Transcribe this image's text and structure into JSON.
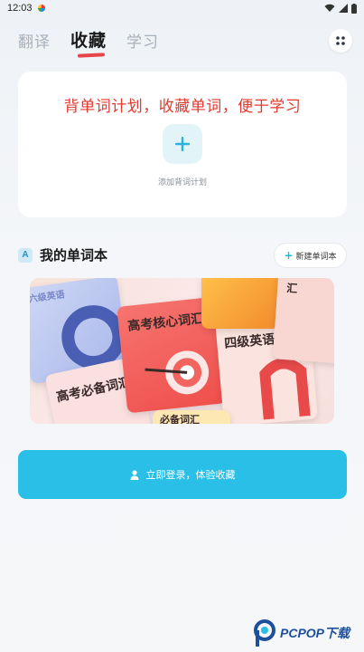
{
  "status_bar": {
    "time": "12:03"
  },
  "tabs": [
    {
      "label": "翻译",
      "active": false
    },
    {
      "label": "收藏",
      "active": true
    },
    {
      "label": "学习",
      "active": false
    }
  ],
  "plan_card": {
    "title": "背单词计划，收藏单词，便于学习",
    "add_label": "添加背词计划"
  },
  "wordbook_section": {
    "icon_letter": "A",
    "title": "我的单词本",
    "new_button_label": "新建单词本"
  },
  "banner": {
    "books": [
      "高考核心词汇",
      "四级英语词汇",
      "高考必备词汇",
      "六级英语",
      "汇",
      "必备词汇"
    ]
  },
  "login_button": {
    "label": "立即登录，体验收藏"
  },
  "watermark": {
    "text": "PCPOP下载"
  },
  "colors": {
    "accent": "#29bfe7",
    "title_red": "#e0392e",
    "tab_underline": "#e8454a"
  }
}
